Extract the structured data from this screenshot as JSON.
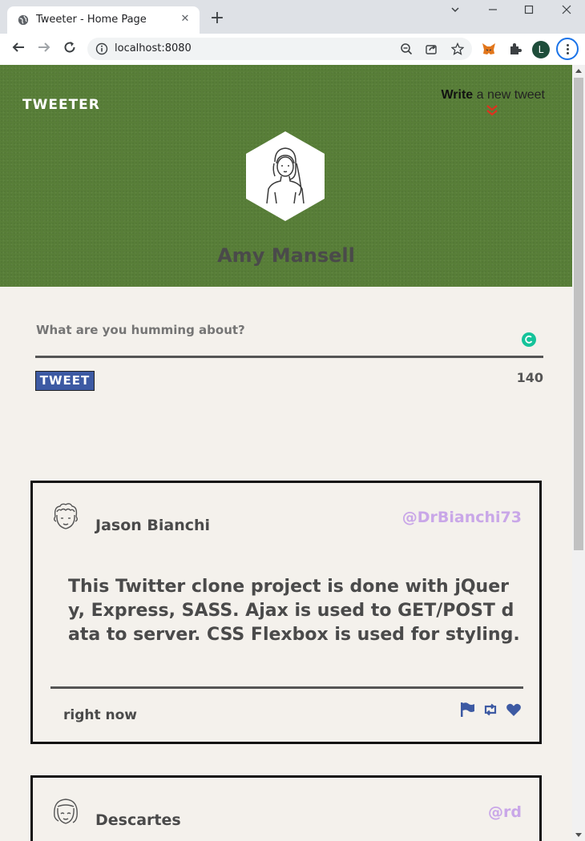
{
  "browser": {
    "tab_title": "Tweeter - Home Page",
    "url": "localhost:8080",
    "profile_initial": "L",
    "new_tab_label": "+"
  },
  "header": {
    "brand": "TWEETER",
    "write_bold": "Write",
    "write_rest": " a new tweet",
    "user_name": "Amy Mansell"
  },
  "compose": {
    "placeholder": "What are you humming about?",
    "button_label": "TWEET",
    "counter": "140"
  },
  "tweets": [
    {
      "name": "Jason Bianchi",
      "handle": "@DrBianchi73",
      "text": "This Twitter clone project is done with jQuery, Express, SASS. Ajax is used to GET/POST data to server. CSS Flexbox is used for styling.",
      "time": "right now",
      "avatar_icon": "curly-hair-avatar-icon"
    },
    {
      "name": "Descartes",
      "handle": "@rd",
      "avatar_icon": "bob-hair-avatar-icon"
    }
  ],
  "colors": {
    "header_green": "#587e38",
    "page_bg": "#f4f1ec",
    "tweet_button": "#3d5aa3",
    "handle": "#c9a7e8",
    "chevron": "#e0301e"
  }
}
